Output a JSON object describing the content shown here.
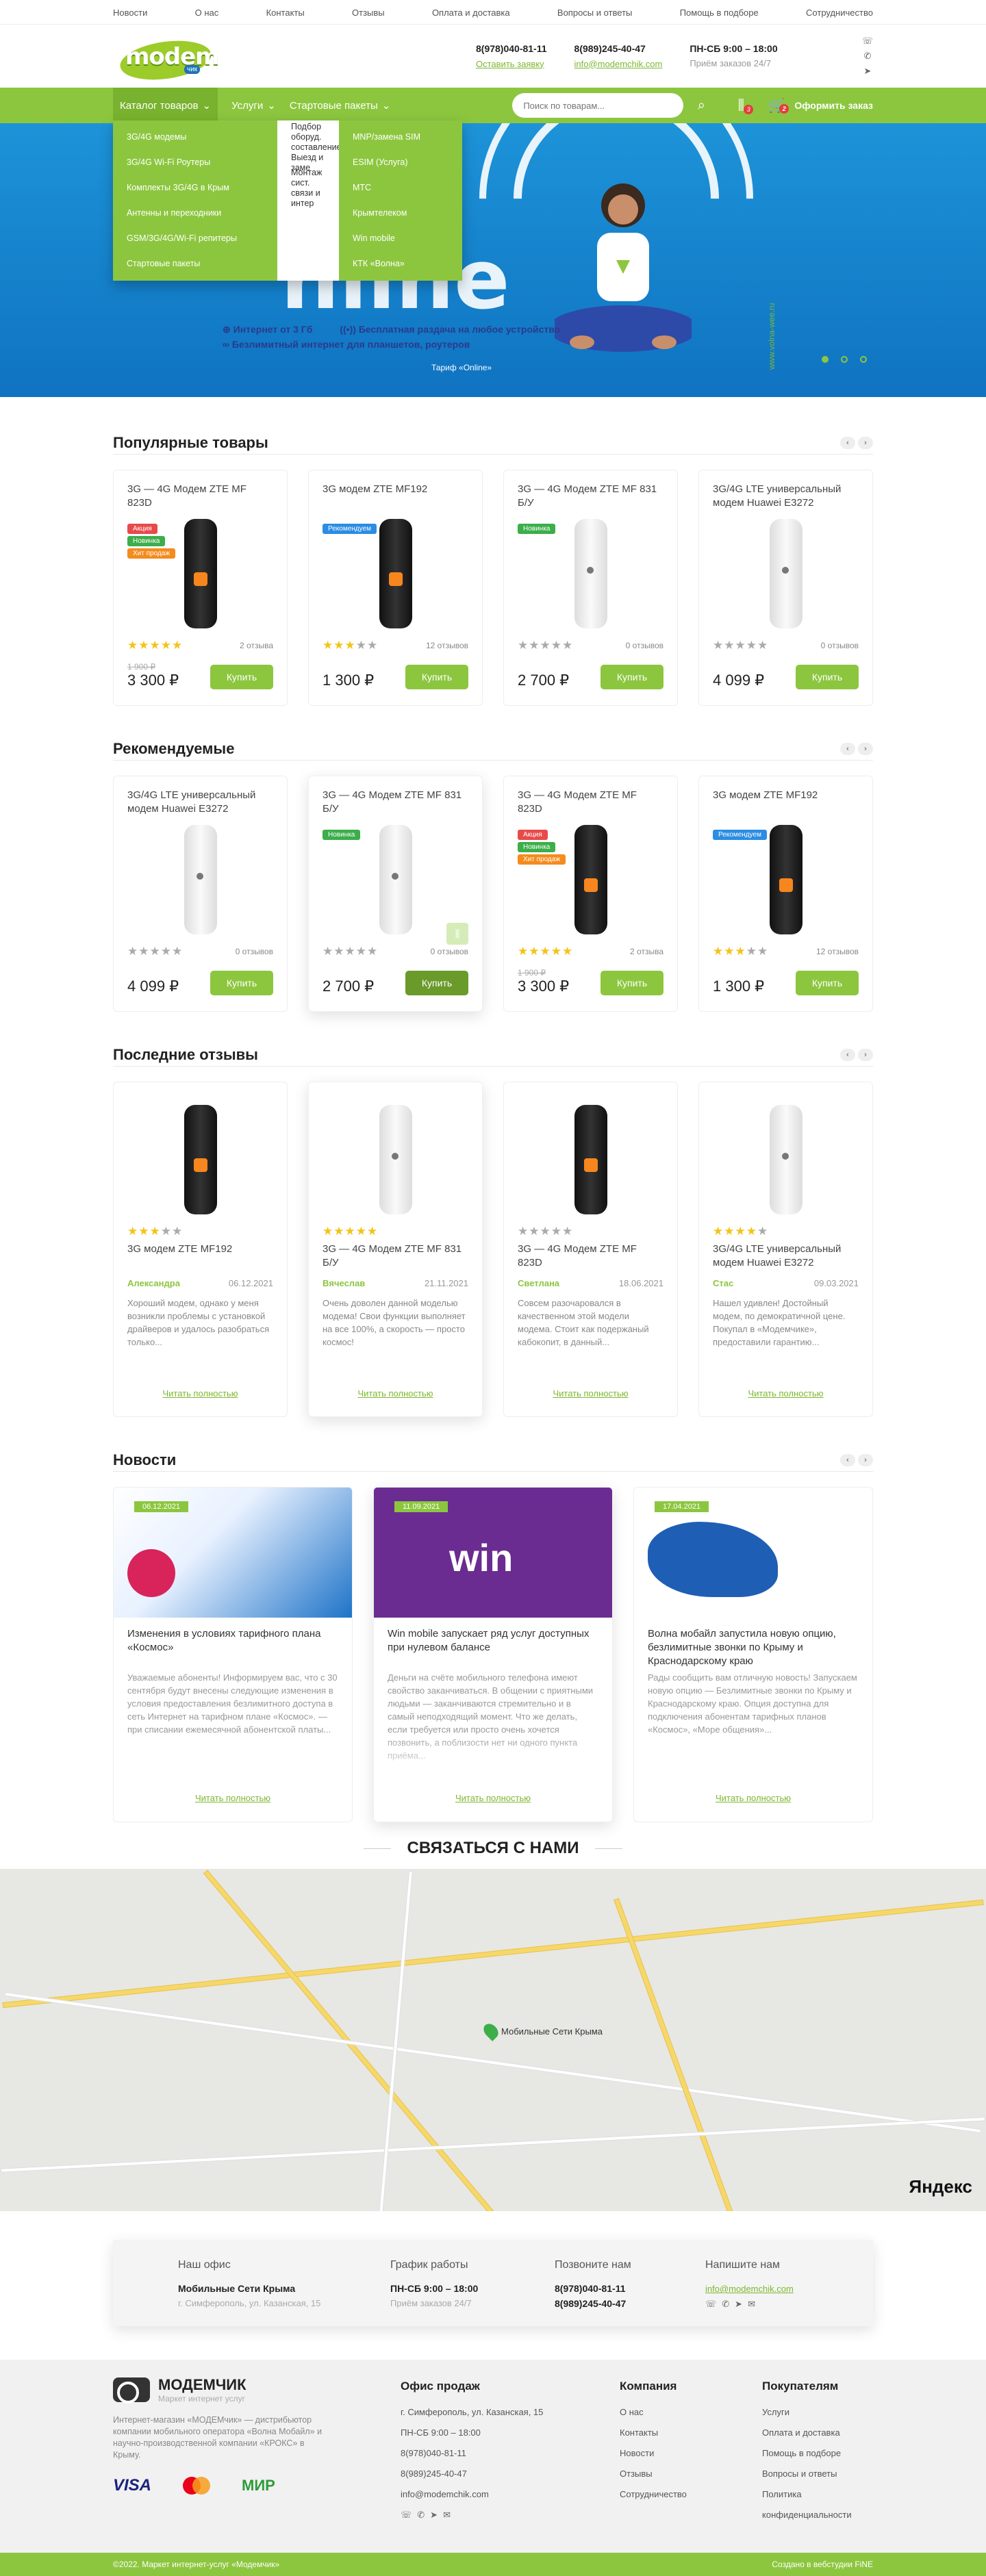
{
  "topnav": [
    "Новости",
    "О нас",
    "Контакты",
    "Отзывы",
    "Оплата и доставка",
    "Вопросы и ответы",
    "Помощь в подборе",
    "Сотрудничество"
  ],
  "header": {
    "logo_text": "modem",
    "logo_sub": "чик",
    "phone1": "8(978)040-81-11",
    "callback": "Оставить заявку",
    "phone2": "8(989)245-40-47",
    "email": "info@modemchik.com",
    "hours": "ПН-СБ 9:00 – 18:00",
    "orders": "Приём заказов 24/7"
  },
  "nav": {
    "catalog": "Каталог товаров",
    "services": "Услуги",
    "packs": "Стартовые пакеты",
    "search_placeholder": "Поиск по товарам...",
    "compare_count": "3",
    "cart_count": "2",
    "order": "Оформить заказ"
  },
  "dropdown": {
    "catalog": [
      "3G/4G модемы",
      "3G/4G Wi-Fi Роутеры",
      "Комплекты 3G/4G в Крым",
      "Антенны и переходники",
      "GSM/3G/4G/Wi-Fi репитеры",
      "Стартовые пакеты"
    ],
    "services": [
      "Подбор оборуд. составление",
      "Выезд и заме",
      "Монтаж сист. связи и интер"
    ],
    "packs": [
      "MNP/замена SIM",
      "ESIM (Услуга)",
      "МТС",
      "Крымтелеком",
      "Win mobile",
      "КТК «Волна»"
    ]
  },
  "hero": {
    "big": "nline",
    "feat1": "Интернет от 3 Гб",
    "feat2": "Бесплатная раздача на любое устройство",
    "feat3": "Безлимитный интернет для планшетов, роутеров",
    "tariff": "Тариф «Online»",
    "site": "www.volna-wee.ru",
    "tar_tab": "Тари"
  },
  "sections": {
    "popular": "Популярные товары",
    "recommended": "Рекомендуемые",
    "reviews": "Последние отзывы",
    "news": "Новости",
    "contact": "СВЯЗАТЬСЯ С НАМИ"
  },
  "buy_label": "Купить",
  "popular": [
    {
      "name": "3G — 4G Модем ZTE MF 823D",
      "color": "black",
      "labels": [
        [
          "Акция",
          "lb-red"
        ],
        [
          "Новинка",
          "lb-green"
        ],
        [
          "Хит продаж",
          "lb-orange"
        ]
      ],
      "stars": 5,
      "reviews": "2 отзыва",
      "old": "1 900 ₽",
      "price": "3 300 ₽"
    },
    {
      "name": "3G модем ZTE MF192",
      "color": "black",
      "labels": [
        [
          "Рекомендуем",
          "lb-blue"
        ]
      ],
      "stars": 3,
      "reviews": "12 отзывов",
      "old": "",
      "price": "1 300 ₽"
    },
    {
      "name": "3G — 4G Модем ZTE MF 831 Б/У",
      "color": "white",
      "labels": [
        [
          "Новинка",
          "lb-green"
        ]
      ],
      "stars": 0,
      "reviews": "0 отзывов",
      "old": "",
      "price": "2 700 ₽"
    },
    {
      "name": "3G/4G LTE универсальный модем Huawei E3272",
      "color": "white",
      "labels": [],
      "stars": 0,
      "reviews": "0 отзывов",
      "old": "",
      "price": "4 099 ₽"
    }
  ],
  "recommended": [
    {
      "name": "3G/4G LTE универсальный модем Huawei E3272",
      "color": "white",
      "labels": [],
      "stars": 0,
      "reviews": "0 отзывов",
      "old": "",
      "price": "4 099 ₽"
    },
    {
      "name": "3G — 4G Модем ZTE MF 831 Б/У",
      "color": "white",
      "labels": [
        [
          "Новинка",
          "lb-green"
        ]
      ],
      "stars": 0,
      "reviews": "0 отзывов",
      "old": "",
      "price": "2 700 ₽"
    },
    {
      "name": "3G — 4G Модем ZTE MF 823D",
      "color": "black",
      "labels": [
        [
          "Акция",
          "lb-red"
        ],
        [
          "Новинка",
          "lb-green"
        ],
        [
          "Хит продаж",
          "lb-orange"
        ]
      ],
      "stars": 5,
      "reviews": "2 отзыва",
      "old": "1 900 ₽",
      "price": "3 300 ₽"
    },
    {
      "name": "3G модем ZTE MF192",
      "color": "black",
      "labels": [
        [
          "Рекомендуем",
          "lb-blue"
        ]
      ],
      "stars": 3,
      "reviews": "12 отзывов",
      "old": "",
      "price": "1 300 ₽"
    }
  ],
  "reviews": [
    {
      "model": "3G модем ZTE MF192",
      "color": "black",
      "stars": 3,
      "author": "Александра",
      "date": "06.12.2021",
      "text": "Хороший модем, однако у меня возникли проблемы с установкой драйверов и удалось разобраться только..."
    },
    {
      "model": "3G — 4G Модем ZTE MF 831 Б/У",
      "color": "white",
      "stars": 5,
      "author": "Вячеслав",
      "date": "21.11.2021",
      "text": "Очень доволен данной моделью модема! Свои функции выполняет на все 100%, а скорость — просто космос!"
    },
    {
      "model": "3G — 4G Модем ZTE MF 823D",
      "color": "black",
      "stars": 0,
      "author": "Светлана",
      "date": "18.06.2021",
      "text": "Совсем разочаровался в качественном этой модели модема. Стоит как подержаный кабокопит, в данный..."
    },
    {
      "model": "3G/4G LTE универсальный модем Huawei E3272",
      "color": "white",
      "stars": 4,
      "author": "Стас",
      "date": "09.03.2021",
      "text": "Нашел удивлен! Достойный модем, по демократичной цене. Покупал в «Модемчике», предоставили гарантию..."
    }
  ],
  "more_label": "Читать полностью",
  "news": [
    {
      "date": "06.12.2021",
      "title": "Изменения в условиях тарифного плана «Космос»",
      "text": "Уважаемые абоненты! Информируем вас, что с 30 сентября будут внесены следующие изменения в условия предоставления безлимитного доступа в сеть Интернет на тарифном плане «Космос». — при списании ежемесячной абонентской платы..."
    },
    {
      "date": "11.09.2021",
      "title": "Win mobile запускает ряд услуг доступных при нулевом балансе",
      "text": "Деньги на счёте мобильного телефона имеют свойство заканчиваться. В общении с приятными людьми — заканчиваются стремительно и в самый неподходящий момент. Что же делать, если требуется или просто очень хочется позвонить, а поблизости нет ни одного пункта приёма..."
    },
    {
      "date": "17.04.2021",
      "title": "Волна мобайл запустила новую опцию, безлимитные звонки по Крыму и Краснодарскому краю",
      "text": "Рады сообщить вам отличную новость! Запускаем новую опцию — Безлимитные звонки по Крыму и Краснодарскому краю. Опция доступна для подключения абонентам тарифных планов «Космос», «Море общения»..."
    }
  ],
  "map": {
    "pin": "Мобильные Сети Крыма",
    "yandex": "Яндекс"
  },
  "office": {
    "h1": "Наш офис",
    "name": "Мобильные Сети Крыма",
    "addr": "г. Симферополь, ул. Казанская, 15",
    "h2": "График работы",
    "hours": "ПН-СБ 9:00 – 18:00",
    "orders": "Приём заказов 24/7",
    "h3": "Позвоните нам",
    "p1": "8(978)040-81-11",
    "p2": "8(989)245-40-47",
    "h4": "Напишите нам",
    "email": "info@modemchik.com"
  },
  "footer": {
    "brand": "МОДЕМЧИК",
    "tag": "Маркет интернет услуг",
    "about": "Интернет-магазин «МОДЕМчик» — дистрибьютор компании мобильного оператора «Волна Мобайл» и научно-производственной компании «КРОКС» в Крыму.",
    "visa": "VISA",
    "mir": "МИР",
    "office_h": "Офис продаж",
    "office": [
      "г. Симферополь, ул. Казанская, 15",
      "ПН-СБ 9:00 – 18:00",
      "8(978)040-81-11",
      "8(989)245-40-47",
      "info@modemchik.com"
    ],
    "company_h": "Компания",
    "company": [
      "О нас",
      "Контакты",
      "Новости",
      "Отзывы",
      "Сотрудничество"
    ],
    "buyers_h": "Покупателям",
    "buyers": [
      "Услуги",
      "Оплата и доставка",
      "Помощь в подборе",
      "Вопросы и ответы",
      "Политика конфиденциальности"
    ]
  },
  "bottom": {
    "copy": "©2022. Маркет интернет-услуг «Модемчик»",
    "made": "Создано в вебстудии FiNE"
  }
}
